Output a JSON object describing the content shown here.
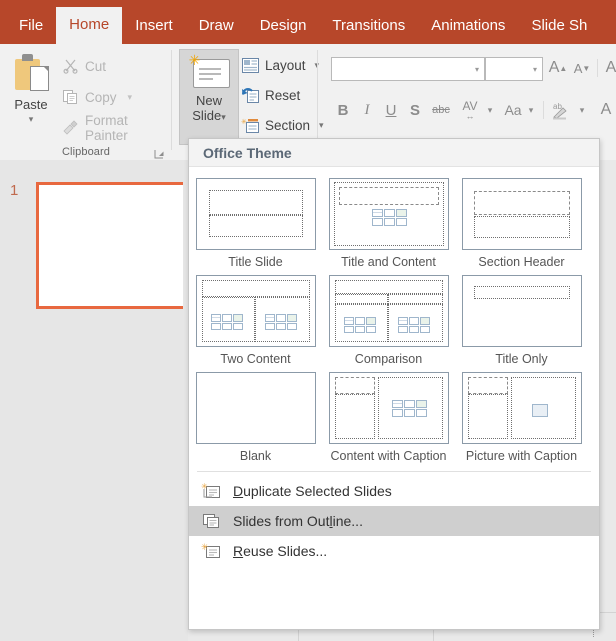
{
  "app": {
    "accent_color": "#b7472a",
    "selection_color": "#e8683f"
  },
  "ribbon": {
    "tabs": [
      {
        "label": "File",
        "active": false
      },
      {
        "label": "Home",
        "active": true
      },
      {
        "label": "Insert",
        "active": false
      },
      {
        "label": "Draw",
        "active": false
      },
      {
        "label": "Design",
        "active": false
      },
      {
        "label": "Transitions",
        "active": false
      },
      {
        "label": "Animations",
        "active": false
      },
      {
        "label": "Slide Sh",
        "active": false
      }
    ],
    "groups": {
      "clipboard": {
        "label": "Clipboard",
        "paste": {
          "label": "Paste",
          "caret": "▾"
        },
        "items": [
          {
            "label": "Cut",
            "has_caret": false
          },
          {
            "label": "Copy",
            "has_caret": true,
            "caret": "▾"
          },
          {
            "label": "Format Painter",
            "has_caret": false
          }
        ]
      },
      "slides": {
        "new_slide": {
          "line1": "New",
          "line2": "Slide",
          "caret": "▾"
        },
        "items": [
          {
            "label": "Layout",
            "has_caret": true,
            "caret": "▾"
          },
          {
            "label": "Reset",
            "has_caret": false
          },
          {
            "label": "Section",
            "has_caret": true,
            "caret": "▾"
          }
        ]
      },
      "font": {
        "font_name_value": "",
        "font_size_value": "",
        "grow_font": "A",
        "shrink_font": "A",
        "bold": "B",
        "italic": "I",
        "underline": "U",
        "shadow": "S",
        "strikethrough": "abc",
        "character_spacing": "AV",
        "change_case": "Aa",
        "text_highlight": "ab",
        "font_color": "A"
      }
    }
  },
  "thumbnail_pane": {
    "slides": [
      {
        "number": "1",
        "selected": true
      }
    ]
  },
  "new_slide_dropdown": {
    "header": "Office Theme",
    "layouts": [
      {
        "name": "Title Slide"
      },
      {
        "name": "Title and Content"
      },
      {
        "name": "Section Header"
      },
      {
        "name": "Two Content"
      },
      {
        "name": "Comparison"
      },
      {
        "name": "Title Only"
      },
      {
        "name": "Blank"
      },
      {
        "name": "Content with Caption"
      },
      {
        "name": "Picture with Caption"
      }
    ],
    "menu_items": [
      {
        "label": "Duplicate Selected Slides",
        "accel": "D",
        "rest": "uplicate Selected Slides",
        "pre": "",
        "highlighted": false,
        "icon": "duplicate-slides-icon"
      },
      {
        "label": "Slides from Outline...",
        "accel": "l",
        "pre": "Slides from Out",
        "rest": "ine...",
        "highlighted": true,
        "icon": "slides-from-outline-icon"
      },
      {
        "label": "Reuse Slides...",
        "accel": "R",
        "pre": "",
        "rest": "euse Slides...",
        "highlighted": false,
        "icon": "reuse-slides-icon"
      }
    ]
  }
}
